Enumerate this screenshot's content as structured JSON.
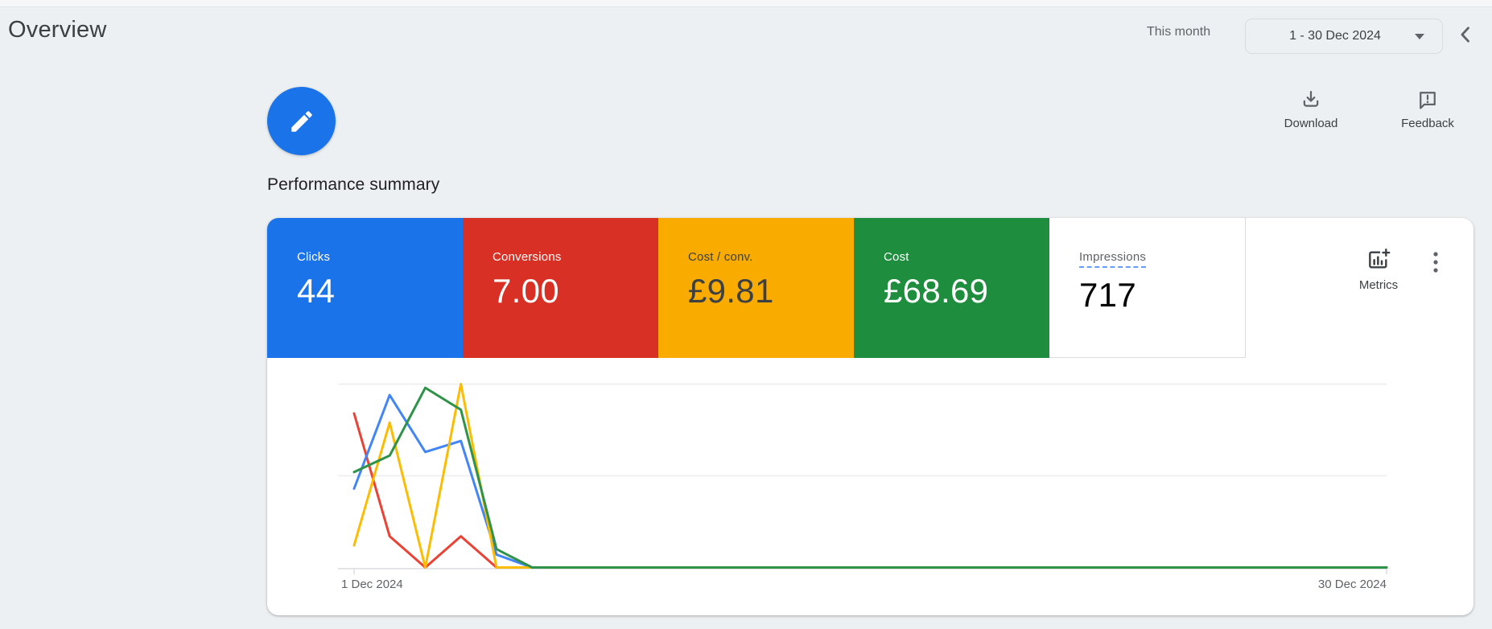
{
  "header": {
    "title": "Overview",
    "period_label": "This month",
    "date_range": "1 - 30 Dec 2024"
  },
  "toolbar": {
    "download_label": "Download",
    "feedback_label": "Feedback"
  },
  "summary": {
    "title": "Performance summary"
  },
  "scorecards": [
    {
      "label": "Clicks",
      "value": "44",
      "bg": "#1a73e8",
      "fg": "#ffffff"
    },
    {
      "label": "Conversions",
      "value": "7.00",
      "bg": "#d93025",
      "fg": "#ffffff"
    },
    {
      "label": "Cost / conv.",
      "value": "£9.81",
      "bg": "#f9ab00",
      "fg": "#3c4043"
    },
    {
      "label": "Cost",
      "value": "£68.69",
      "bg": "#1e8e3e",
      "fg": "#ffffff"
    },
    {
      "label": "Impressions",
      "value": "717",
      "bg": "#ffffff",
      "fg": "#3c4043",
      "underline_color": "#669df6"
    }
  ],
  "metrics_button": {
    "label": "Metrics"
  },
  "chart_data": {
    "type": "line",
    "title": "Performance summary daily trend",
    "x_axis": {
      "start_label": "1 Dec 2024",
      "end_label": "30 Dec 2024",
      "days": 30
    },
    "y_axis": {
      "tick_labels_visible": false,
      "gridlines": [
        0.5,
        1.0
      ],
      "note": "no numeric y labels shown; values normalized so 1.0 = top gridline"
    },
    "series": [
      {
        "name": "Conversions",
        "color": "#ea4335",
        "values": [
          0.84,
          0.17,
          0,
          0.17,
          0,
          0,
          0,
          0,
          0,
          0,
          0,
          0,
          0,
          0,
          0,
          0,
          0,
          0,
          0,
          0,
          0,
          0,
          0,
          0,
          0,
          0,
          0,
          0,
          0,
          0
        ]
      },
      {
        "name": "Clicks",
        "color": "#4285f4",
        "values": [
          0.43,
          0.94,
          0.63,
          0.69,
          0.07,
          0,
          0,
          0,
          0,
          0,
          0,
          0,
          0,
          0,
          0,
          0,
          0,
          0,
          0,
          0,
          0,
          0,
          0,
          0,
          0,
          0,
          0,
          0,
          0,
          0
        ]
      },
      {
        "name": "Cost / conv.",
        "color": "#fbbc04",
        "values": [
          0.12,
          0.79,
          0,
          1,
          0,
          0,
          0,
          0,
          0,
          0,
          0,
          0,
          0,
          0,
          0,
          0,
          0,
          0,
          0,
          0,
          0,
          0,
          0,
          0,
          0,
          0,
          0,
          0,
          0,
          0
        ]
      },
      {
        "name": "Cost",
        "color": "#2e9248",
        "values": [
          0.52,
          0.61,
          0.98,
          0.86,
          0.1,
          0,
          0,
          0,
          0,
          0,
          0,
          0,
          0,
          0,
          0,
          0,
          0,
          0,
          0,
          0,
          0,
          0,
          0,
          0,
          0,
          0,
          0,
          0,
          0,
          0
        ]
      }
    ],
    "legend_visible": false
  }
}
